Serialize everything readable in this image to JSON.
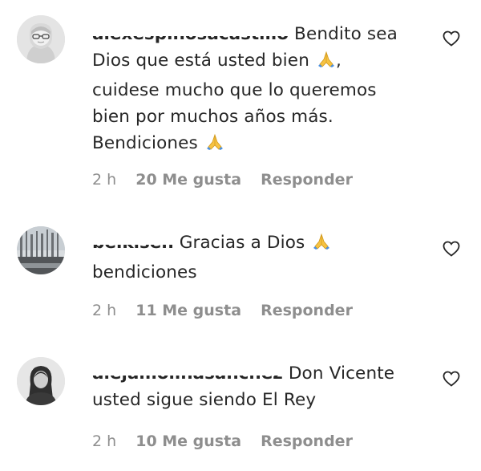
{
  "comments": [
    {
      "username": "alexespinosacastillo",
      "text": "Bendito sea Dios que está usted bien 🙏, cuidese mucho que lo queremos bien por muchos años más. Bendiciones 🙏",
      "text_parts": [
        "Bendito sea",
        "Dios que está usted bien",
        ",",
        "cuidese mucho que lo queremos",
        "bien por muchos años más.",
        "Bendiciones"
      ],
      "time": "2 h",
      "likes": "20 Me gusta",
      "reply_label": "Responder",
      "avatar_icon": "woman-with-glasses-avatar"
    },
    {
      "username": "belkisen",
      "text": "Gracias a Dios 🙏 bendiciones",
      "text_parts": [
        "Gracias a Dios",
        "bendiciones"
      ],
      "time": "2 h",
      "likes": "11 Me gusta",
      "reply_label": "Responder",
      "avatar_icon": "landscape-avatar"
    },
    {
      "username": "alejamolinasanchez",
      "text": "Don Vicente usted sigue siendo El Rey",
      "text_parts": [
        "Don Vicente",
        "usted sigue siendo El Rey"
      ],
      "time": "2 h",
      "likes": "10 Me gusta",
      "reply_label": "Responder",
      "avatar_icon": "woman-avatar"
    }
  ],
  "icons": {
    "like": "heart-outline-icon",
    "emoji": "folded-hands-emoji"
  },
  "colors": {
    "text": "#262626",
    "meta": "#8e8e8e",
    "background": "#ffffff"
  }
}
